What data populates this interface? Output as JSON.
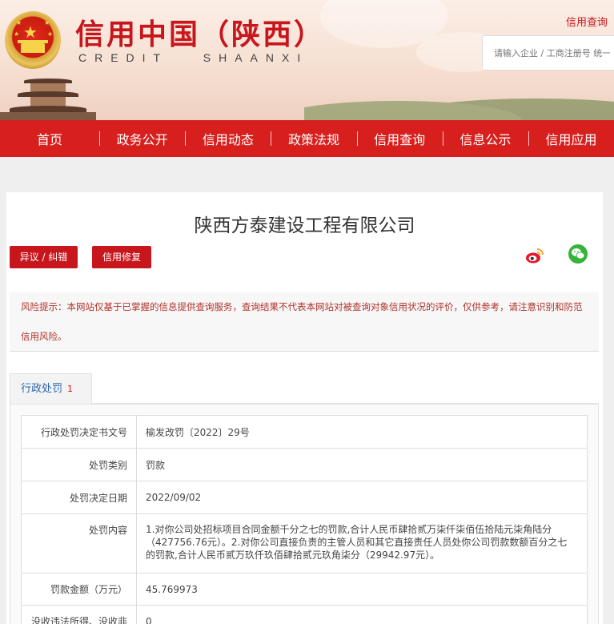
{
  "header": {
    "site_title": "信用中国（陕西）",
    "site_subtitle": "CREDIT SHAANXI",
    "top_link": "信用查询",
    "search_placeholder": "请输入企业 / 工商注册号 统一社会信用代码"
  },
  "nav": {
    "items": [
      "首页",
      "政务公开",
      "信用动态",
      "政策法规",
      "信用查询",
      "信息公示",
      "信用应用"
    ]
  },
  "company": {
    "name": "陕西方泰建设工程有限公司",
    "objection_button": "异议 / 纠错",
    "repair_button": "信用修复",
    "share_icons": [
      "weibo-icon",
      "wechat-icon"
    ]
  },
  "notice": {
    "text": "风险提示：本网站仅基于已掌握的信息提供查询服务，查询结果不代表本网站对被查询对象信用状况的评价，仅供参考，请注意识别和防范信用风险。"
  },
  "tabs": [
    {
      "label": "行政处罚",
      "count": "1"
    }
  ],
  "penalty": {
    "rows": [
      {
        "key": "行政处罚决定书文号",
        "value": "榆发改罚〔2022〕29号"
      },
      {
        "key": "处罚类别",
        "value": "罚款"
      },
      {
        "key": "处罚决定日期",
        "value": "2022/09/02"
      },
      {
        "key": "处罚内容",
        "value": "1.对你公司处招标项目合同金额千分之七的罚款,合计人民币肆拾贰万柒仟柒佰伍拾陆元柒角陆分（427756.76元）。2.对你公司直接负责的主管人员和其它直接责任人员处你公司罚款数额百分之七的罚款,合计人民币贰万玖仟玖佰肆拾贰元玖角柒分（29942.97元）。"
      },
      {
        "key": "罚款金额（万元）",
        "value": "45.769973"
      },
      {
        "key": "没收违法所得、没收非",
        "value": "0"
      }
    ]
  },
  "colors": {
    "brand_red": "#c8161d",
    "nav_red": "#d7201e",
    "tab_blue": "#2a66b0",
    "wechat_green": "#35b33a"
  }
}
